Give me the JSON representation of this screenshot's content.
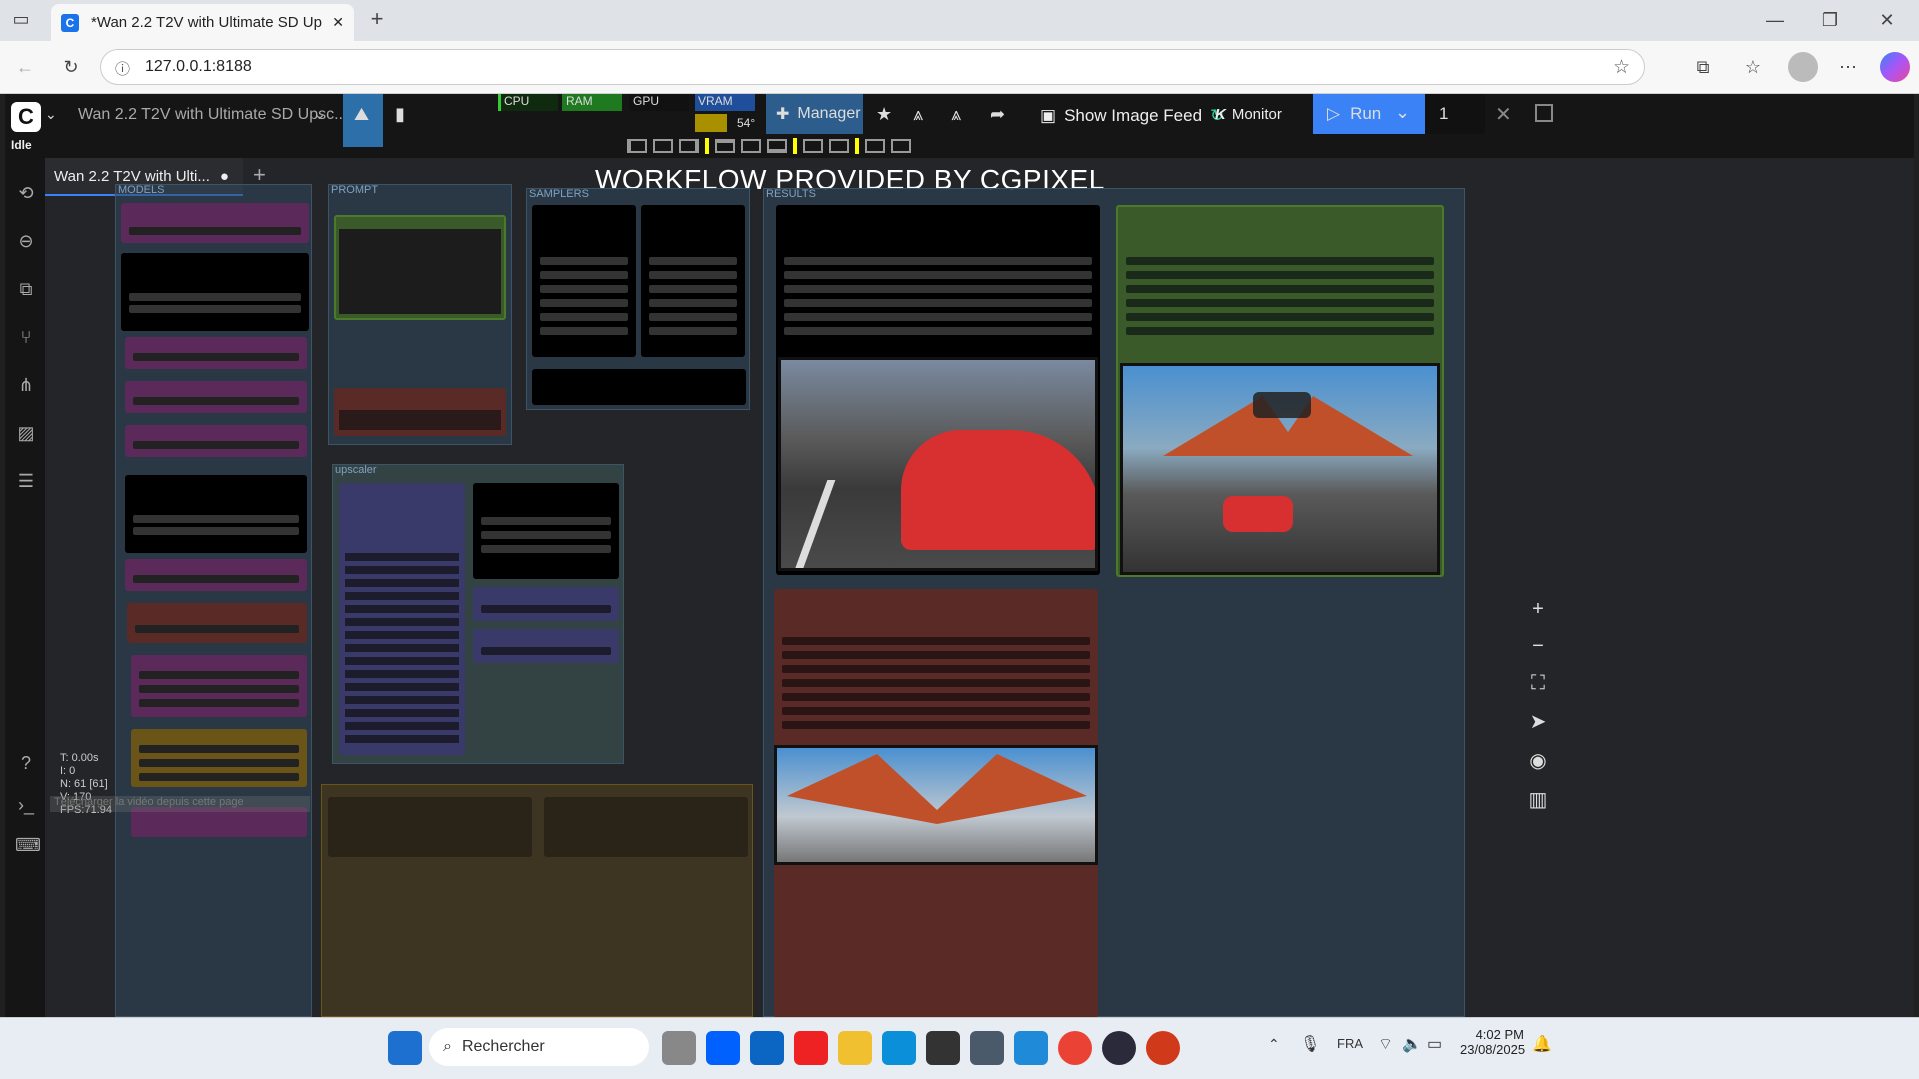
{
  "browser": {
    "tab_title": "*Wan 2.2 T2V with Ultimate SD Up",
    "url": "127.0.0.1:8188",
    "new_tab": "+",
    "min": "—",
    "max": "❐",
    "close": "✕"
  },
  "app": {
    "workflow_name": "Wan 2.2 T2V with Ultimate SD Upsc...",
    "status": "Idle",
    "resources": {
      "cpu": "CPU",
      "ram": "RAM",
      "gpu": "GPU",
      "vram": "VRAM",
      "temp": "54°"
    },
    "manager_label": "Manager",
    "show_image_feed": "Show Image Feed",
    "monitor": "Monitor",
    "run_label": "Run",
    "queue_count": "1",
    "tab_label": "Wan 2.2 T2V with Ulti...",
    "tab_add": "+",
    "canvas_title": "WORKFLOW PROVIDED BY CGPIXEL",
    "groups": {
      "models": "MODELS",
      "prompt": "PROMPT",
      "samplers": "SAMPLERS",
      "results": "RESULTS",
      "upscaler": "upscaler"
    },
    "stats": {
      "t": "T: 0.00s",
      "i": "I: 0",
      "n": "N: 61 [61]",
      "v": "V: 170",
      "fps": "FPS:71.94"
    },
    "hint": "Télécharger la vidéo depuis cette page"
  },
  "taskbar": {
    "search": "Rechercher",
    "lang": "FRA",
    "time": "4:02 PM",
    "date": "23/08/2025"
  },
  "colors": {
    "accent_blue": "#3b82f6",
    "node_purple": "#5b2a5a",
    "node_green": "#3a5a2a",
    "node_brown": "#5a2a26",
    "node_gold": "#6a5418",
    "node_indigo": "#3a3a6a"
  }
}
